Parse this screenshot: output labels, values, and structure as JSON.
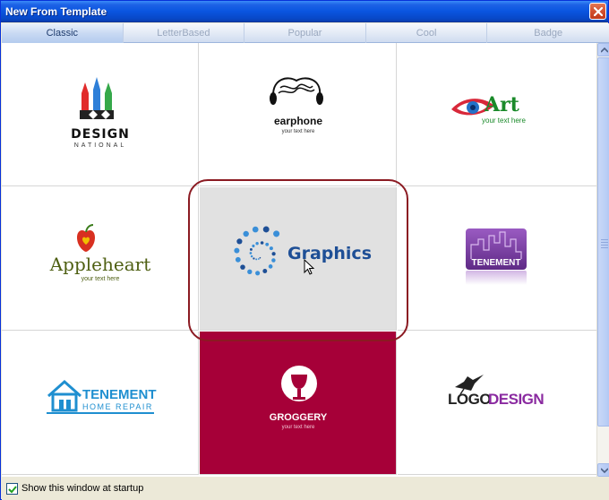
{
  "window": {
    "title": "New From Template"
  },
  "tabs": [
    {
      "label": "Classic",
      "active": true
    },
    {
      "label": "LetterBased",
      "active": false
    },
    {
      "label": "Popular",
      "active": false
    },
    {
      "label": "Cool",
      "active": false
    },
    {
      "label": "Badge",
      "active": false
    }
  ],
  "templates": [
    {
      "name": "DESIGN",
      "subtitle": "NATIONAL",
      "icon": "pencils-icon"
    },
    {
      "name": "earphone",
      "subtitle": "your text here",
      "icon": "earphone-icon"
    },
    {
      "name": "Art",
      "subtitle": "your text here",
      "icon": "eye-icon"
    },
    {
      "name": "Appleheart",
      "subtitle": "your text here",
      "icon": "apple-heart-icon"
    },
    {
      "name": "Graphics",
      "subtitle": "",
      "icon": "dot-spiral-icon",
      "state": "hovered-selected"
    },
    {
      "name": "TENEMENT",
      "subtitle": "",
      "icon": "city-skyline-icon"
    },
    {
      "name": "TENEMENT",
      "subtitle": "HOME REPAIR",
      "icon": "house-icon"
    },
    {
      "name": "GROGGERY",
      "subtitle": "your text here",
      "icon": "goblet-icon"
    },
    {
      "name": "LOGODESIGN",
      "name_part1": "LOGO",
      "name_part2": "DESIGN",
      "subtitle": "",
      "icon": "bird-icon"
    }
  ],
  "footer": {
    "show_at_startup_label": "Show this window at startup",
    "show_at_startup_checked": true
  },
  "colors": {
    "titlebar": "#0a55e0",
    "selection_ring": "#8b1a22",
    "groggery_bg": "#a60038",
    "graphics_blue": "#1e5aa8",
    "tenement_purple": "#7b3fa0",
    "art_green": "#1a8a2a"
  }
}
